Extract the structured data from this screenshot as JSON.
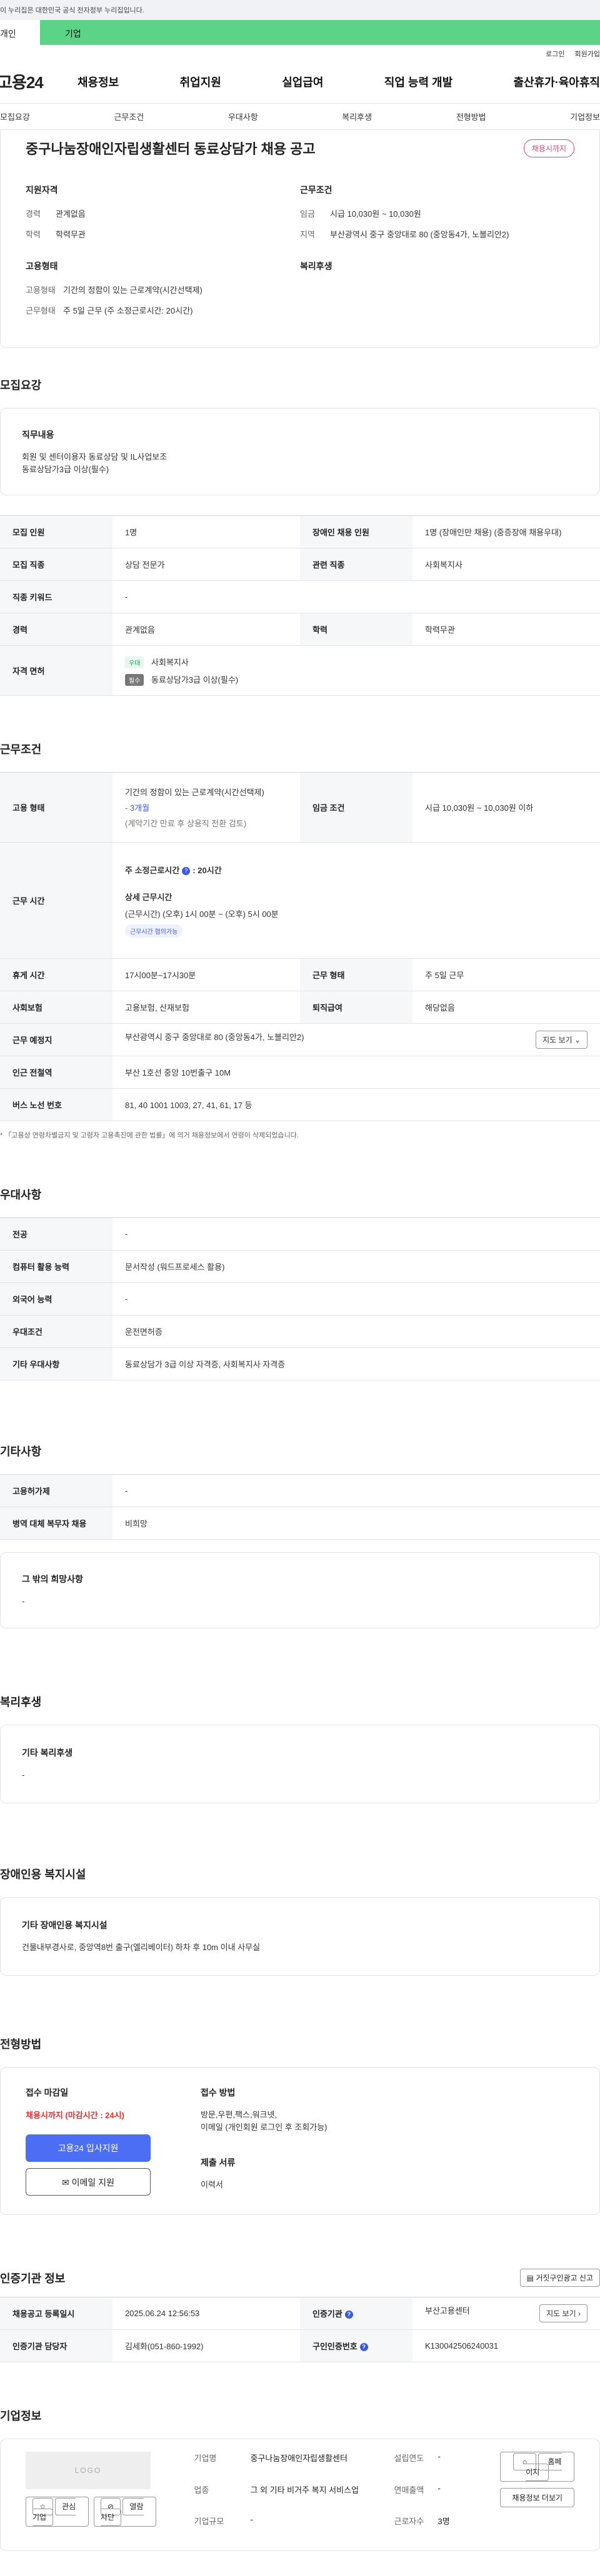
{
  "gov_banner": "이 누리집은 대한민국 공식 전자정부 누리집입니다.",
  "user_type": {
    "personal": "개인",
    "company": "기업"
  },
  "util": {
    "login": "로그인",
    "join": "회원가입"
  },
  "logo": "고용24",
  "gnb": [
    "채용정보",
    "취업지원",
    "실업급여",
    "직업 능력 개발",
    "출산휴가·육아휴직"
  ],
  "tabs": [
    "모집요강",
    "근무조건",
    "우대사항",
    "복리후생",
    "전형방법",
    "기업정보"
  ],
  "summary": {
    "title": "중구나눔장애인자립생활센터 동료상담가 채용 공고",
    "deadline_badge": "채용시까지",
    "qual_head": "지원자격",
    "career_k": "경력",
    "career_v": "관계없음",
    "edu_k": "학력",
    "edu_v": "학력무관",
    "emp_head": "고용형태",
    "emptype_k": "고용형태",
    "emptype_v": "기간의 정함이 있는 근로계약(시간선택제)",
    "worktype_k": "근무형태",
    "worktype_v": "주 5일 근무 (주 소정근로시간: 20시간)",
    "cond_head": "근무조건",
    "wage_k": "임금",
    "wage_v": "시급 10,030원 ~ 10,030원",
    "region_k": "지역",
    "region_v": "부산광역시 중구 중앙대로 80 (중앙동4가, 노블리안2)",
    "welfare_head": "복리후생"
  },
  "recruit": {
    "title": "모집요강",
    "duty_head": "직무내용",
    "duty_text_1": "회원 및 센터이용자 동료상담 및 IL사업보조",
    "duty_text_2": "동료상담가3급 이상(필수)",
    "rows": {
      "headcount_k": "모집 인원",
      "headcount_v": "1명",
      "disabled_k": "장애인 채용 인원",
      "disabled_v": "1명 (장애인만 채용) (중증장애 채용우대)",
      "job_k": "모집 직종",
      "job_v": "상담 전문가",
      "related_k": "관련 직종",
      "related_v": "사회복지사",
      "keyword_k": "직종 키워드",
      "keyword_v": "-",
      "career_k": "경력",
      "career_v": "관계없음",
      "edu_k": "학력",
      "edu_v": "학력무관",
      "cert_k": "자격 면허",
      "cert1_badge": "우대",
      "cert1": "사회복지사",
      "cert2_badge": "필수",
      "cert2": "동료상담가3급 이상(필수)"
    }
  },
  "conditions": {
    "title": "근무조건",
    "emptype_k": "고용 형태",
    "emptype_v1": "기간의 정함이 있는 근로계약(시간선택제)",
    "emptype_v2": "- 3개월",
    "emptype_v3": "(계약기간 만료 후 상용직 전환 검토)",
    "wage_k": "임금 조건",
    "wage_v": "시급 10,030원 ~ 10,030원 이하",
    "hours_k": "근무 시간",
    "hours_v1": "주 소정근로시간",
    "hours_v1b": ": 20시간",
    "hours_detail_head": "상세 근무시간",
    "hours_detail": "(근무시간) (오후) 1시 00분 ~ (오후) 5시 00분",
    "hours_pill": "근무시간 협의가능",
    "break_k": "휴게 시간",
    "break_v": "17시00분~17시30분",
    "worktype_k": "근무 형태",
    "worktype_v": "주 5일 근무",
    "insurance_k": "사회보험",
    "insurance_v": "고용보험, 산재보험",
    "severance_k": "퇴직급여",
    "severance_v": "해당없음",
    "place_k": "근무 예정지",
    "place_v": "부산광역시 중구 중앙대로 80 (중앙동4가, 노블리안2)",
    "map_btn": "지도 보기",
    "subway_k": "인근 전철역",
    "subway_v": "부산 1호선 중앙 10번출구 10M",
    "bus_k": "버스 노선 번호",
    "bus_v": "81, 40 1001 1003, 27, 41, 61, 17 등",
    "note": "* 「고용상 연령차별금지 및 고령자 고용촉진에 관한 법률」에 의거 채용정보에서 연령이 삭제되었습니다."
  },
  "preference": {
    "title": "우대사항",
    "major_k": "전공",
    "major_v": "-",
    "computer_k": "컴퓨터 활용 능력",
    "computer_v": "문서작성 (워드프로세스 활용)",
    "lang_k": "외국어 능력",
    "lang_v": "-",
    "cond_k": "우대조건",
    "cond_v": "운전면허증",
    "etc_k": "기타 우대사항",
    "etc_v": "동료상담가 3급 이상 자격증, 사회복지사 자격증"
  },
  "others": {
    "title": "기타사항",
    "keep_k": "고용허가제",
    "keep_v": "-",
    "military_k": "병역 대체 복무자 채용",
    "military_v": "비희망",
    "etc_head": "그 밖의 희망사항",
    "etc_v": "-"
  },
  "welfare": {
    "title": "복리후생",
    "head": "기타 복리후생",
    "v": "-"
  },
  "facility": {
    "title": "장애인용 복지시설",
    "head": "기타 장애인용 복지시설",
    "v": "건물내부경사로, 중앙역8번 출구(엘리베이터) 하차 후 10m 이내 사무실"
  },
  "selection": {
    "title": "전형방법",
    "deadline_head": "접수 마감일",
    "deadline_v": "채용시까지 (마감시간 : 24시)",
    "apply_btn": "고용24 입사지원",
    "email_btn": "이메일 지원",
    "method_head": "접수 방법",
    "method_v1": "방문,우편,팩스,워크넷,",
    "method_v2": "이메일 (개인회원 로그인 후 조회가능)",
    "docs_head": "제출 서류",
    "docs_v": "이력서"
  },
  "agency": {
    "title": "인증기관 정보",
    "report_btn": "거짓구인광고 신고",
    "reg_k": "채용공고 등록일시",
    "reg_v": "2025.06.24 12:56:53",
    "org_k": "인증기관",
    "org_v": "부산고용센터",
    "map_btn": "지도 보기",
    "mgr_k": "인증기관 담당자",
    "mgr_v": "김세화(051-860-1992)",
    "id_k": "구인인증번호",
    "id_v": "K130042506240031"
  },
  "company": {
    "title": "기업정보",
    "logo": "LOGO",
    "fav_btn": "관심기업",
    "block_btn": "열람차단",
    "name_k": "기업명",
    "name_v": "중구나눔장애인자립생활센터",
    "industry_k": "업종",
    "industry_v": "그 외 기타 비거주 복지 서비스업",
    "size_k": "기업규모",
    "size_v": "-",
    "founded_k": "설립연도",
    "founded_v": "-",
    "sales_k": "연매출액",
    "sales_v": "-",
    "staff_k": "근로자수",
    "staff_v": "3명",
    "home_btn": "홈페이지",
    "more_btn": "채용정보 더보기"
  }
}
